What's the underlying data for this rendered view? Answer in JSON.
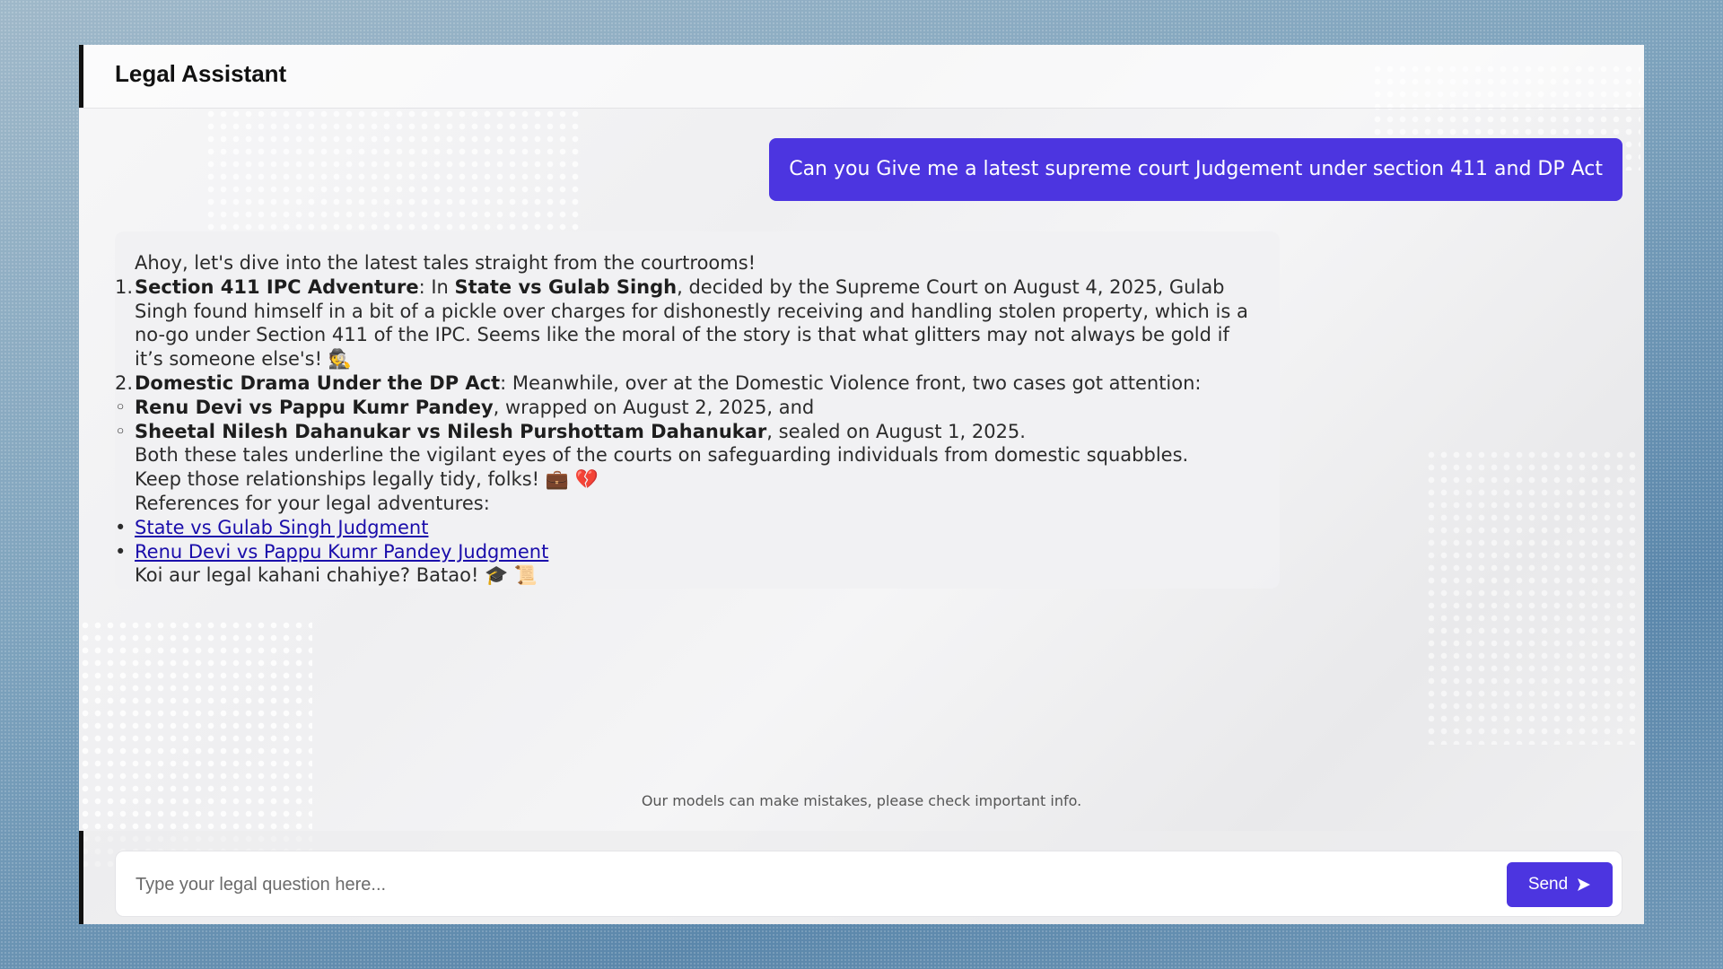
{
  "app": {
    "title": "Legal Assistant"
  },
  "conversation": {
    "user_message": "Can you Give me a latest supreme court Judgement under section 411 and DP Act",
    "assistant": {
      "intro": "Ahoy, let's dive into the latest tales straight from the courtrooms!",
      "item1": {
        "number": "1.",
        "heading": "Section 411 IPC Adventure",
        "pre": ": In ",
        "case": "State vs Gulab Singh",
        "text": ", decided by the Supreme Court on August 4, 2025, Gulab Singh found himself in a bit of a pickle over charges for dishonestly receiving and handling stolen property, which is a no-go under Section 411 of the IPC. Seems like the moral of the story is that what glitters may not always be gold if it’s someone else's! 🕵️"
      },
      "item2": {
        "number": "2.",
        "heading": "Domestic Drama Under the DP Act",
        "text": ": Meanwhile, over at the Domestic Violence front, two cases got attention:"
      },
      "sub_cases": [
        {
          "bullet": "◦",
          "name": "Renu Devi vs Pappu Kumr Pandey",
          "detail": ", wrapped on August 2, 2025, and"
        },
        {
          "bullet": "◦",
          "name": "Sheetal Nilesh Dahanukar vs Nilesh Purshottam Dahanukar",
          "detail": ", sealed on August 1, 2025."
        }
      ],
      "summary": "Both these tales underline the vigilant eyes of the courts on safeguarding individuals from domestic squabbles.",
      "signoff": "Keep those relationships legally tidy, folks! 💼 💔",
      "references_label": "References for your legal adventures:",
      "references": [
        {
          "bullet": "•",
          "label": "State vs Gulab Singh Judgment"
        },
        {
          "bullet": "•",
          "label": "Renu Devi vs Pappu Kumr Pandey Judgment"
        }
      ],
      "closing": "Koi aur legal kahani chahiye? Batao! 🎓 📜"
    }
  },
  "footer": {
    "disclaimer": "Our models can make mistakes, please check important info."
  },
  "composer": {
    "placeholder": "Type your legal question here...",
    "send_label": "Send",
    "send_icon": "send-arrow-icon"
  },
  "colors": {
    "accent": "#4c35e0",
    "link": "#1a0dab"
  }
}
